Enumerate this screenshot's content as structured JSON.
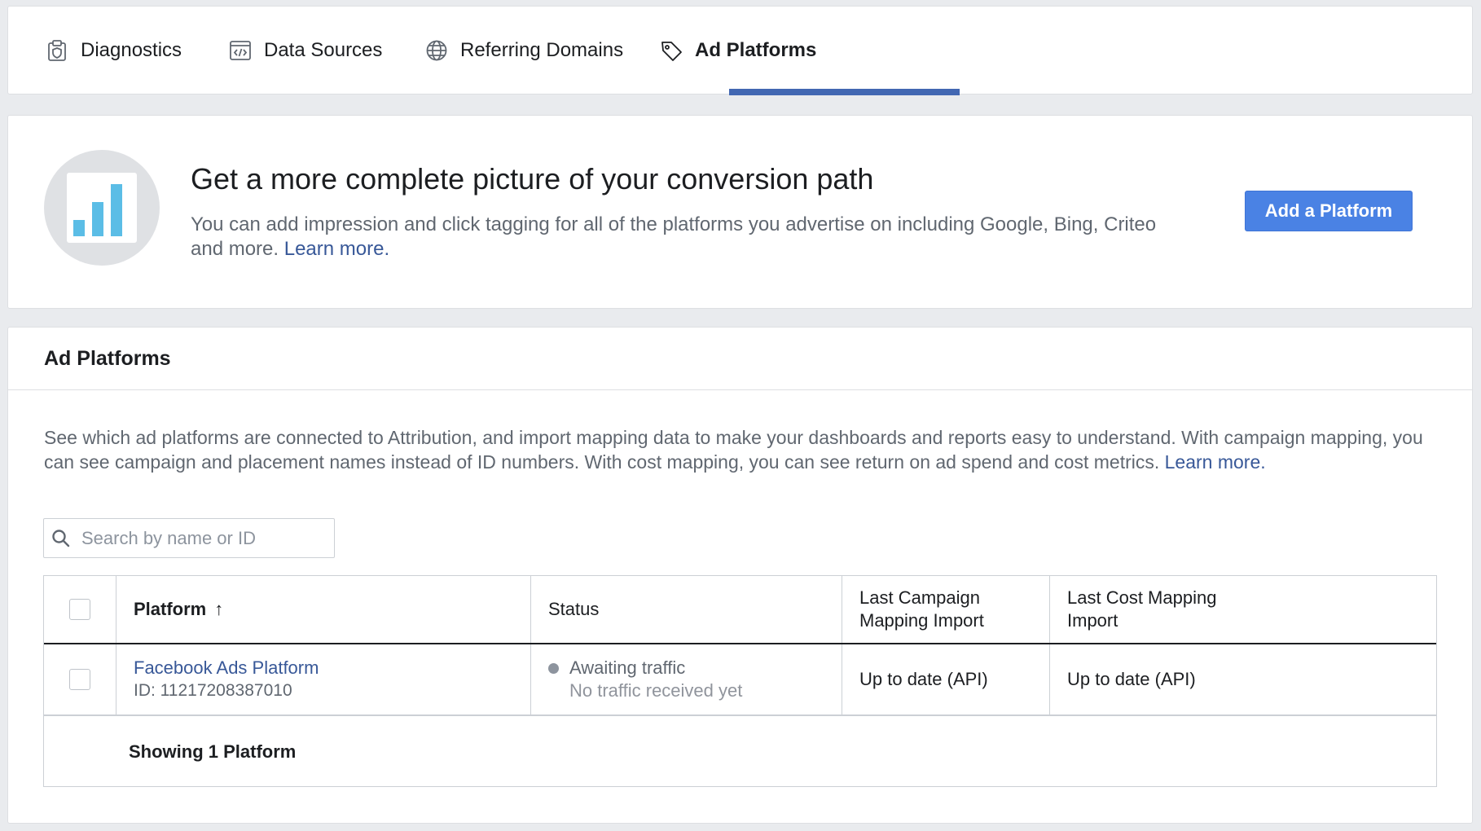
{
  "tabs": [
    {
      "label": "Diagnostics",
      "icon": "clipboard-shield-icon"
    },
    {
      "label": "Data Sources",
      "icon": "code-window-icon"
    },
    {
      "label": "Referring Domains",
      "icon": "globe-icon"
    },
    {
      "label": "Ad Platforms",
      "icon": "tag-icon",
      "active": true
    }
  ],
  "promo": {
    "title": "Get a more complete picture of your conversion path",
    "description": "You can add impression and click tagging for all of the platforms you advertise on including Google, Bing, Criteo and more.",
    "learn_more": "Learn more.",
    "button": "Add a Platform",
    "icon": "bar-chart-icon"
  },
  "list": {
    "title": "Ad Platforms",
    "description": "See which ad platforms are connected to Attribution, and import mapping data to make your dashboards and reports easy to understand. With campaign mapping, you can see campaign and placement names instead of ID numbers. With cost mapping, you can see return on ad spend and cost metrics.",
    "learn_more": "Learn more.",
    "search_placeholder": "Search by name or ID",
    "columns": {
      "platform": "Platform",
      "status": "Status",
      "last_campaign": "Last Campaign Mapping Import",
      "last_cost": "Last Cost Mapping Import"
    },
    "rows": [
      {
        "name": "Facebook Ads Platform",
        "id": "ID: 11217208387010",
        "status": "Awaiting traffic",
        "status_detail": "No traffic received yet",
        "last_campaign": "Up to date (API)",
        "last_cost": "Up to date (API)"
      }
    ],
    "footer": "Showing 1 Platform"
  },
  "colors": {
    "accent": "#4267b2",
    "button": "#4a82e4",
    "link": "#385898",
    "chart_bars": "#5bbde6"
  }
}
